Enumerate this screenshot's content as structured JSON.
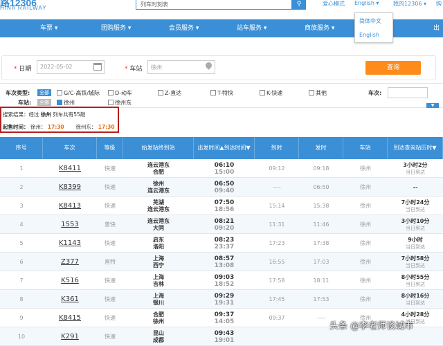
{
  "header": {
    "logo_text": "路12306",
    "logo_sub": "HINA RAILWAY",
    "search_placeholder": "列车时刻表",
    "links": [
      "爱心模式",
      "English ▾",
      "我的12306 ▾",
      "购"
    ]
  },
  "nav": {
    "items": [
      "车票 ▾",
      "团购服务 ▾",
      "会员服务 ▾",
      "站车服务 ▾",
      "商旅服务 ▾",
      "出"
    ]
  },
  "lang_menu": [
    "简体中文",
    "English"
  ],
  "query": {
    "date_label": "日期",
    "date_value": "2022-05-02",
    "station_label": "车站",
    "station_value": "徐州",
    "query_button": "查询"
  },
  "filters": {
    "type_label": "车次类型:",
    "all_label": "全部",
    "types": [
      "G/C-高铁/城际",
      "D-动车",
      "Z-直达",
      "T-特快",
      "K-快速",
      "其他"
    ],
    "train_no_label": "车次:",
    "station_label": "车站:",
    "station_all": "全部",
    "stations": [
      "徐州",
      "徐州东"
    ]
  },
  "results": {
    "summary_prefix": "搜索结果：经过",
    "summary_station": "徐州",
    "summary_suffix": "列车共有55趟",
    "sale_label": "起售时间：",
    "sale_items": [
      {
        "station": "徐州：",
        "time": "17:30"
      },
      {
        "station": "徐州东：",
        "time": "17:30"
      }
    ]
  },
  "table": {
    "headers": [
      "序号",
      "车次",
      "等级",
      "始发站\n终到站",
      "出发时间▲\n到达时间▼",
      "到时",
      "发时",
      "车站",
      "到达查询站历时▼"
    ],
    "rows": [
      {
        "no": "1",
        "train": "K8411",
        "grade": "快速",
        "from": "连云港东",
        "to": "合肥",
        "dep": "06:10",
        "arr": "15:00",
        "at": "09:12",
        "dt": "09:18",
        "st": "徐州",
        "dur": "3小时2分",
        "day": "当日到达"
      },
      {
        "no": "2",
        "train": "K8399",
        "grade": "快速",
        "from": "徐州",
        "to": "连云港东",
        "dep": "06:50",
        "arr": "09:40",
        "at": "----",
        "dt": "06:50",
        "st": "徐州",
        "dur": "--",
        "day": ""
      },
      {
        "no": "3",
        "train": "K8413",
        "grade": "快速",
        "from": "芜湖",
        "to": "连云港东",
        "dep": "07:50",
        "arr": "18:56",
        "at": "15:14",
        "dt": "15:38",
        "st": "徐州",
        "dur": "7小时24分",
        "day": "当日到达"
      },
      {
        "no": "4",
        "train": "1553",
        "grade": "普快",
        "from": "连云港东",
        "to": "大同",
        "dep": "08:21",
        "arr": "09:20",
        "at": "11:31",
        "dt": "11:46",
        "st": "徐州",
        "dur": "3小时10分",
        "day": "当日到达"
      },
      {
        "no": "5",
        "train": "K1143",
        "grade": "快速",
        "from": "启东",
        "to": "洛阳",
        "dep": "08:23",
        "arr": "23:37",
        "at": "17:23",
        "dt": "17:38",
        "st": "徐州",
        "dur": "9小时",
        "day": "当日到达"
      },
      {
        "no": "6",
        "train": "Z377",
        "grade": "直特",
        "from": "上海",
        "to": "西宁",
        "dep": "08:57",
        "arr": "13:08",
        "at": "16:55",
        "dt": "17:03",
        "st": "徐州",
        "dur": "7小时58分",
        "day": "当日到达"
      },
      {
        "no": "7",
        "train": "K516",
        "grade": "快速",
        "from": "上海",
        "to": "吉林",
        "dep": "09:03",
        "arr": "18:52",
        "at": "17:58",
        "dt": "18:11",
        "st": "徐州",
        "dur": "8小时55分",
        "day": "当日到达"
      },
      {
        "no": "8",
        "train": "K361",
        "grade": "快速",
        "from": "上海",
        "to": "银川",
        "dep": "09:29",
        "arr": "19:31",
        "at": "17:45",
        "dt": "17:53",
        "st": "徐州",
        "dur": "8小时16分",
        "day": "当日到达"
      },
      {
        "no": "9",
        "train": "K8415",
        "grade": "快速",
        "from": "合肥",
        "to": "徐州",
        "dep": "09:37",
        "arr": "14:05",
        "at": "09:37",
        "dt": "----",
        "st": "徐州",
        "dur": "4小时28分",
        "day": "当日到达"
      },
      {
        "no": "10",
        "train": "K291",
        "grade": "快速",
        "from": "昆山",
        "to": "成都",
        "dep": "09:43",
        "arr": "19:01",
        "at": "",
        "dt": "",
        "st": "",
        "dur": "",
        "day": ""
      }
    ]
  },
  "watermark": "头条 @李老师谈城市"
}
